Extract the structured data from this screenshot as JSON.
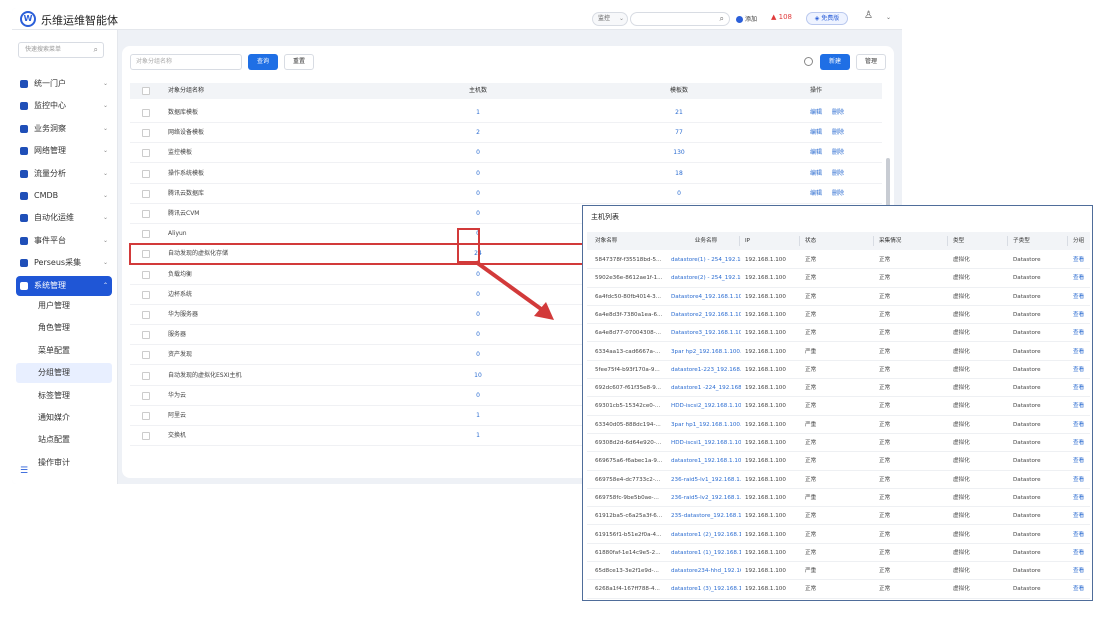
{
  "topbar": {
    "brand": "乐维运维智能体",
    "select_label": "监控",
    "add_label": "添加",
    "alarm_count": "108",
    "free_label": "免费版"
  },
  "sidebar": {
    "search_placeholder": "快速搜索菜单",
    "menu": [
      {
        "label": "统一门户"
      },
      {
        "label": "监控中心"
      },
      {
        "label": "业务洞察"
      },
      {
        "label": "网络管理"
      },
      {
        "label": "流量分析"
      },
      {
        "label": "CMDB"
      },
      {
        "label": "自动化运维"
      },
      {
        "label": "事件平台"
      },
      {
        "label": "Perseus采集"
      },
      {
        "label": "系统管理"
      }
    ],
    "submenu": [
      {
        "label": "用户管理"
      },
      {
        "label": "角色管理"
      },
      {
        "label": "菜单配置"
      },
      {
        "label": "分组管理"
      },
      {
        "label": "标签管理"
      },
      {
        "label": "通知媒介"
      },
      {
        "label": "站点配置"
      },
      {
        "label": "操作审计"
      }
    ]
  },
  "panel": {
    "filter_placeholder": "对象分组名称",
    "query_label": "查询",
    "reset_label": "重置",
    "new_label": "新建",
    "manage_label": "管理",
    "columns": {
      "name": "对象分组名称",
      "hosts": "主机数",
      "templates": "模板数",
      "ops": "操作"
    },
    "edit_label": "编辑",
    "delete_label": "删除",
    "rows": [
      {
        "name": "数据库模板",
        "hosts": "1",
        "templates": "21"
      },
      {
        "name": "网络设备模板",
        "hosts": "2",
        "templates": "77"
      },
      {
        "name": "监控模板",
        "hosts": "0",
        "templates": "130"
      },
      {
        "name": "操作系统模板",
        "hosts": "0",
        "templates": "18"
      },
      {
        "name": "腾讯云数据库",
        "hosts": "0",
        "templates": "0"
      },
      {
        "name": "腾讯云CVM",
        "hosts": "0",
        "templates": ""
      },
      {
        "name": "Aliyun",
        "hosts": "0",
        "templates": ""
      },
      {
        "name": "自动发现的虚拟化存储",
        "hosts": "24",
        "templates": ""
      },
      {
        "name": "负载均衡",
        "hosts": "0",
        "templates": ""
      },
      {
        "name": "边杯系统",
        "hosts": "0",
        "templates": ""
      },
      {
        "name": "华为服务器",
        "hosts": "0",
        "templates": ""
      },
      {
        "name": "服务器",
        "hosts": "0",
        "templates": ""
      },
      {
        "name": "资产发现",
        "hosts": "0",
        "templates": ""
      },
      {
        "name": "自动发现的虚拟化ESXI主机",
        "hosts": "10",
        "templates": ""
      },
      {
        "name": "华为云",
        "hosts": "0",
        "templates": ""
      },
      {
        "name": "阿里云",
        "hosts": "1",
        "templates": ""
      },
      {
        "name": "交换机",
        "hosts": "1",
        "templates": ""
      }
    ]
  },
  "popup": {
    "title": "主机列表",
    "columns": [
      "对象名称",
      "业务名称",
      "IP",
      "状态",
      "采集情况",
      "类型",
      "子类型",
      "分组"
    ],
    "view_label": "查看",
    "rows": [
      {
        "id": "5847378f-f35518bd-5...",
        "biz": "datastore(1) - 254_192.1€",
        "ip": "192.168.1.100",
        "status": "正常",
        "collect": "正常",
        "type": "虚拟化",
        "sub": "Datastore"
      },
      {
        "id": "5902e36e-8612ae1f-1...",
        "biz": "datastore(2) - 254_192.1€",
        "ip": "192.168.1.100",
        "status": "正常",
        "collect": "正常",
        "type": "虚拟化",
        "sub": "Datastore"
      },
      {
        "id": "6a4fdc50-80fb4014-3...",
        "biz": "Datastore4_192.168.1.10(",
        "ip": "192.168.1.100",
        "status": "正常",
        "collect": "正常",
        "type": "虚拟化",
        "sub": "Datastore"
      },
      {
        "id": "6a4e8d3f-7380a1ea-6...",
        "biz": "Datastore2_192.168.1.10(",
        "ip": "192.168.1.100",
        "status": "正常",
        "collect": "正常",
        "type": "虚拟化",
        "sub": "Datastore"
      },
      {
        "id": "6a4e8d77-07004308-...",
        "biz": "Datastore3_192.168.1.10(",
        "ip": "192.168.1.100",
        "status": "正常",
        "collect": "正常",
        "type": "虚拟化",
        "sub": "Datastore"
      },
      {
        "id": "6334aa13-cad6667a-...",
        "biz": "3par hp2_192.168.1.100...",
        "ip": "192.168.1.100",
        "status": "严重",
        "collect": "正常",
        "type": "虚拟化",
        "sub": "Datastore"
      },
      {
        "id": "5fee75f4-b93f170a-9...",
        "biz": "datastore1-223_192.168.1",
        "ip": "192.168.1.100",
        "status": "正常",
        "collect": "正常",
        "type": "虚拟化",
        "sub": "Datastore"
      },
      {
        "id": "692dc607-f61f35e8-9...",
        "biz": "datastore1 -224_192.168.",
        "ip": "192.168.1.100",
        "status": "正常",
        "collect": "正常",
        "type": "虚拟化",
        "sub": "Datastore"
      },
      {
        "id": "69301cb5-15342ce0-...",
        "biz": "HDD-iscsi2_192.168.1.10(",
        "ip": "192.168.1.100",
        "status": "正常",
        "collect": "正常",
        "type": "虚拟化",
        "sub": "Datastore"
      },
      {
        "id": "63340d05-888dc194-...",
        "biz": "3par hp1_192.168.1.100...",
        "ip": "192.168.1.100",
        "status": "严重",
        "collect": "正常",
        "type": "虚拟化",
        "sub": "Datastore"
      },
      {
        "id": "69308d2d-6d64e920-...",
        "biz": "HDD-iscsi1_192.168.1.10(",
        "ip": "192.168.1.100",
        "status": "正常",
        "collect": "正常",
        "type": "虚拟化",
        "sub": "Datastore"
      },
      {
        "id": "669675a6-f6abec1a-9...",
        "biz": "datastore1_192.168.1.100",
        "ip": "192.168.1.100",
        "status": "正常",
        "collect": "正常",
        "type": "虚拟化",
        "sub": "Datastore"
      },
      {
        "id": "669758e4-dc7733c2-...",
        "biz": "236-raid5-lv1_192.168.1.1",
        "ip": "192.168.1.100",
        "status": "正常",
        "collect": "正常",
        "type": "虚拟化",
        "sub": "Datastore"
      },
      {
        "id": "669758fc-9be5b0ae-...",
        "biz": "236-raid5-lv2_192.168.1.1",
        "ip": "192.168.1.100",
        "status": "严重",
        "collect": "正常",
        "type": "虚拟化",
        "sub": "Datastore"
      },
      {
        "id": "61912ba5-c6a25a3f-6...",
        "biz": "235-datastore_192.168.1.",
        "ip": "192.168.1.100",
        "status": "正常",
        "collect": "正常",
        "type": "虚拟化",
        "sub": "Datastore"
      },
      {
        "id": "619156f1-b51e2f0a-4...",
        "biz": "datastore1 (2)_192.168.1.",
        "ip": "192.168.1.100",
        "status": "正常",
        "collect": "正常",
        "type": "虚拟化",
        "sub": "Datastore"
      },
      {
        "id": "61880faf-1e14c9e5-2...",
        "biz": "datastore1 (1)_192.168.1.",
        "ip": "192.168.1.100",
        "status": "正常",
        "collect": "正常",
        "type": "虚拟化",
        "sub": "Datastore"
      },
      {
        "id": "65d8ce13-3e2f1e9d-...",
        "biz": "datastore234-hhd_192.16",
        "ip": "192.168.1.100",
        "status": "严重",
        "collect": "正常",
        "type": "虚拟化",
        "sub": "Datastore"
      },
      {
        "id": "6268a1f4-167ff788-4...",
        "biz": "datastore1 (3)_192.168.1.",
        "ip": "192.168.1.100",
        "status": "正常",
        "collect": "正常",
        "type": "虚拟化",
        "sub": "Datastore"
      }
    ]
  },
  "colors": {
    "primary": "#1f56d6",
    "link": "#2b6cd1",
    "highlight": "#d23a3a",
    "alarm": "#e03b3b"
  },
  "icons": [
    "logo-icon",
    "search-icon",
    "bell-icon",
    "user-icon",
    "refresh-icon",
    "menu-collapse-icon",
    "arrow-icon"
  ]
}
